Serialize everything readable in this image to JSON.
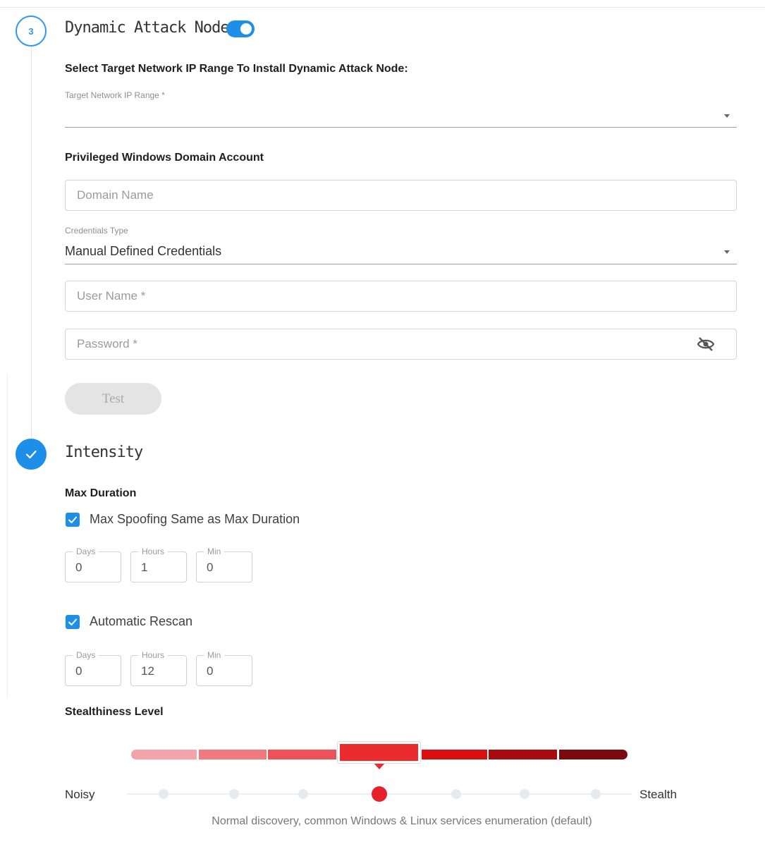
{
  "section3": {
    "step_number": "3",
    "title": "Dynamic Attack Node",
    "toggle_on": true,
    "select_range_heading": "Select Target Network IP Range To Install Dynamic Attack Node:",
    "target_range_label": "Target Network IP Range *",
    "target_range_value": "",
    "domain_account_heading": "Privileged Windows Domain Account",
    "domain_name_placeholder": "Domain Name",
    "credentials_type_label": "Credentials Type",
    "credentials_type_value": "Manual Defined Credentials",
    "username_placeholder": "User Name *",
    "password_placeholder": "Password *",
    "test_button": "Test"
  },
  "intensity": {
    "title": "Intensity",
    "max_duration_heading": "Max Duration",
    "max_spoofing": {
      "label": "Max Spoofing Same as Max Duration",
      "checked": true,
      "days_label": "Days",
      "days": "0",
      "hours_label": "Hours",
      "hours": "1",
      "min_label": "Min",
      "min": "0"
    },
    "auto_rescan": {
      "label": "Automatic Rescan",
      "checked": true,
      "days_label": "Days",
      "days": "0",
      "hours_label": "Hours",
      "hours": "12",
      "min_label": "Min",
      "min": "0"
    },
    "stealthiness": {
      "heading": "Stealthiness Level",
      "left_label": "Noisy",
      "right_label": "Stealth",
      "levels": 7,
      "selected_level": 4,
      "level_colors": [
        "#f4a3a8",
        "#f07a80",
        "#ec5257",
        "#ea2c2f",
        "#d90f12",
        "#a80b0f",
        "#7a0a0d"
      ],
      "description": "Normal discovery, common Windows & Linux services enumeration (default)"
    }
  },
  "colors": {
    "accent": "#1e8fe8",
    "selected_dot": "#e8202a"
  }
}
